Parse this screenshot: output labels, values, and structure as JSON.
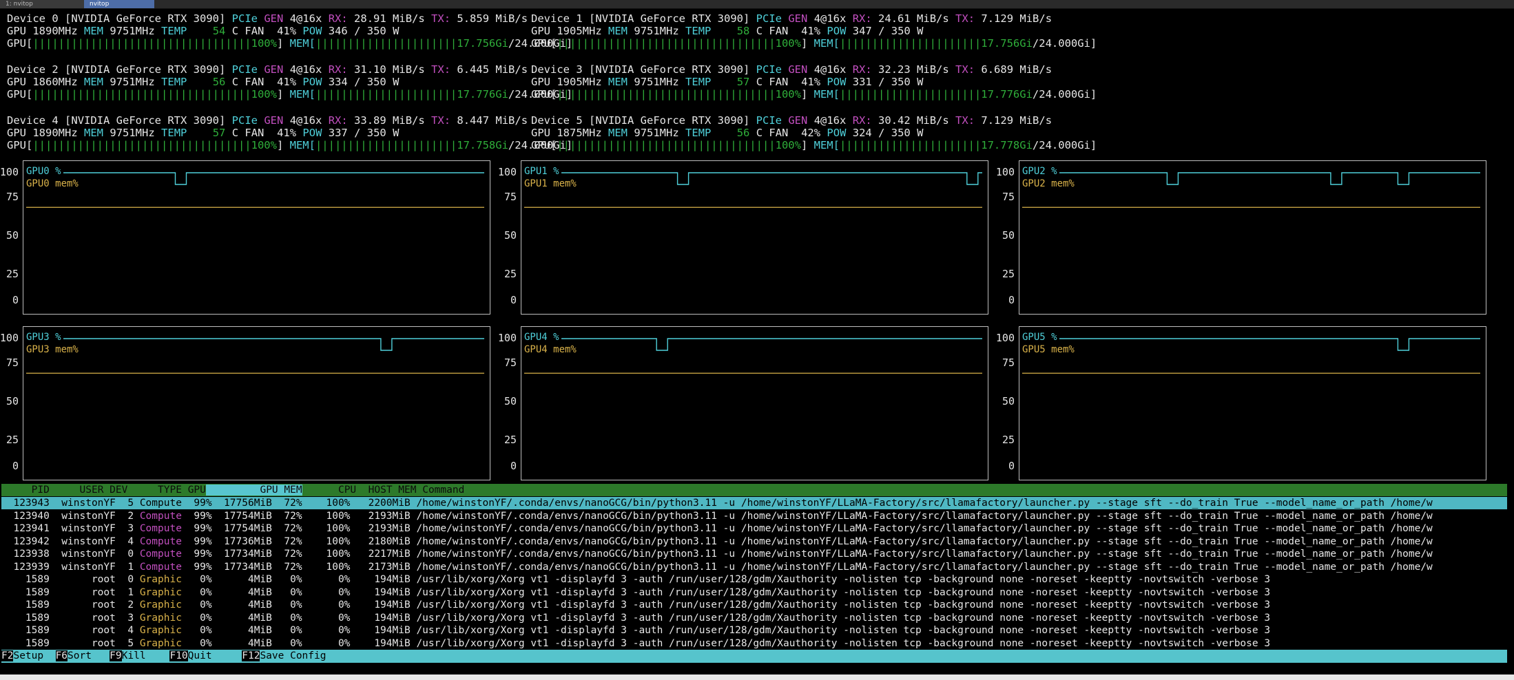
{
  "tabs": [
    {
      "label": "1: nvitop"
    },
    {
      "label": "nvitop"
    }
  ],
  "devices": [
    {
      "id": "0",
      "name": "[NVIDIA GeForce RTX 3090]",
      "pcie": "4@16x",
      "rx": "28.91 MiB/s",
      "tx": "5.859 MiB/s",
      "gpu_clk": "1890MHz",
      "mem_clk": "9751MHz",
      "temp": "54",
      "fan": "41%",
      "pow": "346 / 350 W",
      "gpu_bar": "||||||||||||||||||||||||||||||||||",
      "gpu_util": "100%",
      "mem_bar": "||||||||||||||||||||||",
      "mem_used": "17.756Gi",
      "mem_total": "/24.000Gi]"
    },
    {
      "id": "1",
      "name": "[NVIDIA GeForce RTX 3090]",
      "pcie": "4@16x",
      "rx": "24.61 MiB/s",
      "tx": "7.129 MiB/s",
      "gpu_clk": "1905MHz",
      "mem_clk": "9751MHz",
      "temp": "58",
      "fan": "41%",
      "pow": "347 / 350 W",
      "gpu_bar": "||||||||||||||||||||||||||||||||||",
      "gpu_util": "100%",
      "mem_bar": "||||||||||||||||||||||",
      "mem_used": "17.756Gi",
      "mem_total": "/24.000Gi]"
    },
    {
      "id": "2",
      "name": "[NVIDIA GeForce RTX 3090]",
      "pcie": "4@16x",
      "rx": "31.10 MiB/s",
      "tx": "6.445 MiB/s",
      "gpu_clk": "1860MHz",
      "mem_clk": "9751MHz",
      "temp": "56",
      "fan": "41%",
      "pow": "334 / 350 W",
      "gpu_bar": "||||||||||||||||||||||||||||||||||",
      "gpu_util": "100%",
      "mem_bar": "||||||||||||||||||||||",
      "mem_used": "17.776Gi",
      "mem_total": "/24.000Gi]"
    },
    {
      "id": "3",
      "name": "[NVIDIA GeForce RTX 3090]",
      "pcie": "4@16x",
      "rx": "32.23 MiB/s",
      "tx": "6.689 MiB/s",
      "gpu_clk": "1905MHz",
      "mem_clk": "9751MHz",
      "temp": "57",
      "fan": "41%",
      "pow": "331 / 350 W",
      "gpu_bar": "||||||||||||||||||||||||||||||||||",
      "gpu_util": "100%",
      "mem_bar": "||||||||||||||||||||||",
      "mem_used": "17.776Gi",
      "mem_total": "/24.000Gi]"
    },
    {
      "id": "4",
      "name": "[NVIDIA GeForce RTX 3090]",
      "pcie": "4@16x",
      "rx": "33.89 MiB/s",
      "tx": "8.447 MiB/s",
      "gpu_clk": "1890MHz",
      "mem_clk": "9751MHz",
      "temp": "57",
      "fan": "41%",
      "pow": "337 / 350 W",
      "gpu_bar": "||||||||||||||||||||||||||||||||||",
      "gpu_util": "100%",
      "mem_bar": "||||||||||||||||||||||",
      "mem_used": "17.758Gi",
      "mem_total": "/24.000Gi]"
    },
    {
      "id": "5",
      "name": "[NVIDIA GeForce RTX 3090]",
      "pcie": "4@16x",
      "rx": "30.42 MiB/s",
      "tx": "7.129 MiB/s",
      "gpu_clk": "1875MHz",
      "mem_clk": "9751MHz",
      "temp": "56",
      "fan": "42%",
      "pow": "324 / 350 W",
      "gpu_bar": "||||||||||||||||||||||||||||||||||",
      "gpu_util": "100%",
      "mem_bar": "||||||||||||||||||||||",
      "mem_used": "17.778Gi",
      "mem_total": "/24.000Gi]"
    }
  ],
  "labels": {
    "device": "Device",
    "pcie": "PCIe",
    "gen": "GEN",
    "rx": "RX:",
    "tx": "TX:",
    "gpu": "GPU",
    "mem": "MEM",
    "temp": "TEMP",
    "c": "C",
    "fan": "FAN",
    "pow": "POW",
    "gpu_open": "GPU[",
    "mem_open": "MEM["
  },
  "chart_data": [
    {
      "type": "line",
      "title": "",
      "series": [
        {
          "name": "GPU0 %",
          "dips": [
            0.28
          ]
        },
        {
          "name": "GPU0 mem%",
          "value": 73
        }
      ],
      "yticks": [
        "100",
        "75",
        "50",
        "25",
        "0"
      ],
      "ylim": [
        0,
        100
      ]
    },
    {
      "type": "line",
      "title": "",
      "series": [
        {
          "name": "GPU1 %",
          "dips": [
            0.29,
            0.98
          ]
        },
        {
          "name": "GPU1 mem%",
          "value": 73
        }
      ],
      "yticks": [
        "100",
        "75",
        "50",
        "25",
        "0"
      ],
      "ylim": [
        0,
        100
      ]
    },
    {
      "type": "line",
      "title": "",
      "series": [
        {
          "name": "GPU2 %",
          "dips": [
            0.27,
            0.66,
            0.82
          ]
        },
        {
          "name": "GPU2 mem%",
          "value": 73
        }
      ],
      "yticks": [
        "100",
        "75",
        "50",
        "25",
        "0"
      ],
      "ylim": [
        0,
        100
      ]
    },
    {
      "type": "line",
      "title": "",
      "series": [
        {
          "name": "GPU3 %",
          "dips": [
            0.77
          ]
        },
        {
          "name": "GPU3 mem%",
          "value": 73
        }
      ],
      "yticks": [
        "100",
        "75",
        "50",
        "25",
        "0"
      ],
      "ylim": [
        0,
        100
      ]
    },
    {
      "type": "line",
      "title": "",
      "series": [
        {
          "name": "GPU4 %",
          "dips": [
            0.24
          ]
        },
        {
          "name": "GPU4 mem%",
          "value": 73
        }
      ],
      "yticks": [
        "100",
        "75",
        "50",
        "25",
        "0"
      ],
      "ylim": [
        0,
        100
      ]
    },
    {
      "type": "line",
      "title": "",
      "series": [
        {
          "name": "GPU5 %",
          "dips": [
            0.82
          ]
        },
        {
          "name": "GPU5 mem%",
          "value": 73
        }
      ],
      "yticks": [
        "100",
        "75",
        "50",
        "25",
        "0"
      ],
      "ylim": [
        0,
        100
      ]
    }
  ],
  "table": {
    "headers": {
      "pid": "PID",
      "user": "USER",
      "dev": "DEV",
      "type": "TYPE",
      "gpu": "GPU",
      "gpumem": "GPU MEM",
      "cpu": "CPU",
      "hostmem": "HOST MEM",
      "command": "Command"
    },
    "rows": [
      {
        "pid": "123943",
        "user": "winstonYF",
        "dev": "5",
        "type": "Compute",
        "gpu": "99%",
        "gmem": "17756MiB",
        "gpct": "72%",
        "cpu": "100%",
        "hmem": "2200MiB",
        "cmd": "/home/winstonYF/.conda/envs/nanoGCG/bin/python3.11 -u /home/winstonYF/LLaMA-Factory/src/llamafactory/launcher.py --stage sft --do_train True --model_name_or_path /home/w"
      },
      {
        "pid": "123940",
        "user": "winstonYF",
        "dev": "2",
        "type": "Compute",
        "gpu": "99%",
        "gmem": "17754MiB",
        "gpct": "72%",
        "cpu": "100%",
        "hmem": "2193MiB",
        "cmd": "/home/winstonYF/.conda/envs/nanoGCG/bin/python3.11 -u /home/winstonYF/LLaMA-Factory/src/llamafactory/launcher.py --stage sft --do_train True --model_name_or_path /home/w"
      },
      {
        "pid": "123941",
        "user": "winstonYF",
        "dev": "3",
        "type": "Compute",
        "gpu": "99%",
        "gmem": "17754MiB",
        "gpct": "72%",
        "cpu": "100%",
        "hmem": "2193MiB",
        "cmd": "/home/winstonYF/.conda/envs/nanoGCG/bin/python3.11 -u /home/winstonYF/LLaMA-Factory/src/llamafactory/launcher.py --stage sft --do_train True --model_name_or_path /home/w"
      },
      {
        "pid": "123942",
        "user": "winstonYF",
        "dev": "4",
        "type": "Compute",
        "gpu": "99%",
        "gmem": "17736MiB",
        "gpct": "72%",
        "cpu": "100%",
        "hmem": "2180MiB",
        "cmd": "/home/winstonYF/.conda/envs/nanoGCG/bin/python3.11 -u /home/winstonYF/LLaMA-Factory/src/llamafactory/launcher.py --stage sft --do_train True --model_name_or_path /home/w"
      },
      {
        "pid": "123938",
        "user": "winstonYF",
        "dev": "0",
        "type": "Compute",
        "gpu": "99%",
        "gmem": "17734MiB",
        "gpct": "72%",
        "cpu": "100%",
        "hmem": "2217MiB",
        "cmd": "/home/winstonYF/.conda/envs/nanoGCG/bin/python3.11 -u /home/winstonYF/LLaMA-Factory/src/llamafactory/launcher.py --stage sft --do_train True --model_name_or_path /home/w"
      },
      {
        "pid": "123939",
        "user": "winstonYF",
        "dev": "1",
        "type": "Compute",
        "gpu": "99%",
        "gmem": "17734MiB",
        "gpct": "72%",
        "cpu": "100%",
        "hmem": "2173MiB",
        "cmd": "/home/winstonYF/.conda/envs/nanoGCG/bin/python3.11 -u /home/winstonYF/LLaMA-Factory/src/llamafactory/launcher.py --stage sft --do_train True --model_name_or_path /home/w"
      },
      {
        "pid": "1589",
        "user": "root",
        "dev": "0",
        "type": "Graphic",
        "gpu": "0%",
        "gmem": "4MiB",
        "gpct": "0%",
        "cpu": "0%",
        "hmem": "194MiB",
        "cmd": "/usr/lib/xorg/Xorg vt1 -displayfd 3 -auth /run/user/128/gdm/Xauthority -nolisten tcp -background none -noreset -keeptty -novtswitch -verbose 3"
      },
      {
        "pid": "1589",
        "user": "root",
        "dev": "1",
        "type": "Graphic",
        "gpu": "0%",
        "gmem": "4MiB",
        "gpct": "0%",
        "cpu": "0%",
        "hmem": "194MiB",
        "cmd": "/usr/lib/xorg/Xorg vt1 -displayfd 3 -auth /run/user/128/gdm/Xauthority -nolisten tcp -background none -noreset -keeptty -novtswitch -verbose 3"
      },
      {
        "pid": "1589",
        "user": "root",
        "dev": "2",
        "type": "Graphic",
        "gpu": "0%",
        "gmem": "4MiB",
        "gpct": "0%",
        "cpu": "0%",
        "hmem": "194MiB",
        "cmd": "/usr/lib/xorg/Xorg vt1 -displayfd 3 -auth /run/user/128/gdm/Xauthority -nolisten tcp -background none -noreset -keeptty -novtswitch -verbose 3"
      },
      {
        "pid": "1589",
        "user": "root",
        "dev": "3",
        "type": "Graphic",
        "gpu": "0%",
        "gmem": "4MiB",
        "gpct": "0%",
        "cpu": "0%",
        "hmem": "194MiB",
        "cmd": "/usr/lib/xorg/Xorg vt1 -displayfd 3 -auth /run/user/128/gdm/Xauthority -nolisten tcp -background none -noreset -keeptty -novtswitch -verbose 3"
      },
      {
        "pid": "1589",
        "user": "root",
        "dev": "4",
        "type": "Graphic",
        "gpu": "0%",
        "gmem": "4MiB",
        "gpct": "0%",
        "cpu": "0%",
        "hmem": "194MiB",
        "cmd": "/usr/lib/xorg/Xorg vt1 -displayfd 3 -auth /run/user/128/gdm/Xauthority -nolisten tcp -background none -noreset -keeptty -novtswitch -verbose 3"
      },
      {
        "pid": "1589",
        "user": "root",
        "dev": "5",
        "type": "Graphic",
        "gpu": "0%",
        "gmem": "4MiB",
        "gpct": "0%",
        "cpu": "0%",
        "hmem": "194MiB",
        "cmd": "/usr/lib/xorg/Xorg vt1 -displayfd 3 -auth /run/user/128/gdm/Xauthority -nolisten tcp -background none -noreset -keeptty -novtswitch -verbose 3"
      }
    ]
  },
  "footer": [
    {
      "key": "F2",
      "label": "Setup"
    },
    {
      "key": "F6",
      "label": "Sort"
    },
    {
      "key": "F9",
      "label": "Kill"
    },
    {
      "key": "F10",
      "label": "Quit"
    },
    {
      "key": "F12",
      "label": "Save Config"
    }
  ],
  "colors": {
    "cyan": "#4fd0da",
    "magenta": "#c24fbf",
    "green": "#2fae3a",
    "yellow": "#d9b24a",
    "header_bg": "#2d7a2a",
    "select_bg": "#4fb8c3",
    "footer_bg": "#56c4cc"
  }
}
